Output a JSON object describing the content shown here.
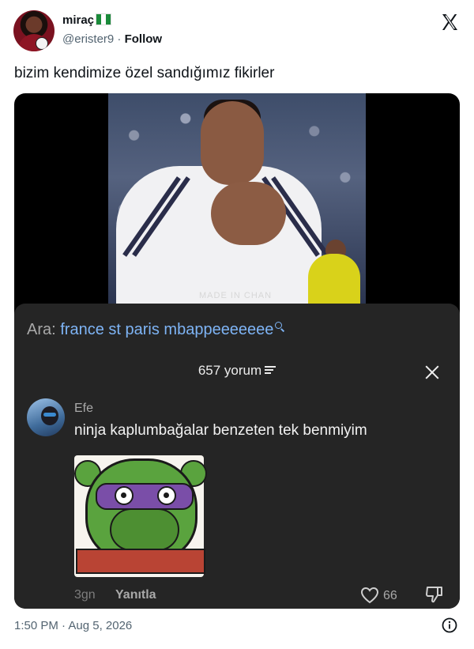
{
  "tweet": {
    "author_name": "miraç",
    "author_handle": "@erister9",
    "separator": " · ",
    "follow_label": "Follow",
    "text": "bizim kendimize özel sandığımız fikirler",
    "timestamp": "1:50 PM · Aug 5, 2026"
  },
  "video": {
    "caption": "MADE IN CHAN"
  },
  "comments_sheet": {
    "search_prefix": "Ara: ",
    "search_query": "france st paris mbappeeeeeee",
    "comment_count": "657 yorum",
    "comment": {
      "author": "Efe",
      "text": "ninja kaplumbağalar benzeten tek benmiyim",
      "time": "3gn",
      "reply_label": "Yanıtla",
      "likes": "66"
    }
  },
  "icons": {
    "brand": "x-logo-icon",
    "search": "search-icon",
    "sort": "sort-icon",
    "close": "close-icon",
    "like": "heart-icon",
    "dislike": "thumbs-down-icon",
    "info": "info-icon"
  },
  "colors": {
    "link_blue": "#7eb4f5",
    "sheet_bg": "#252525",
    "muted_text": "#536471"
  }
}
